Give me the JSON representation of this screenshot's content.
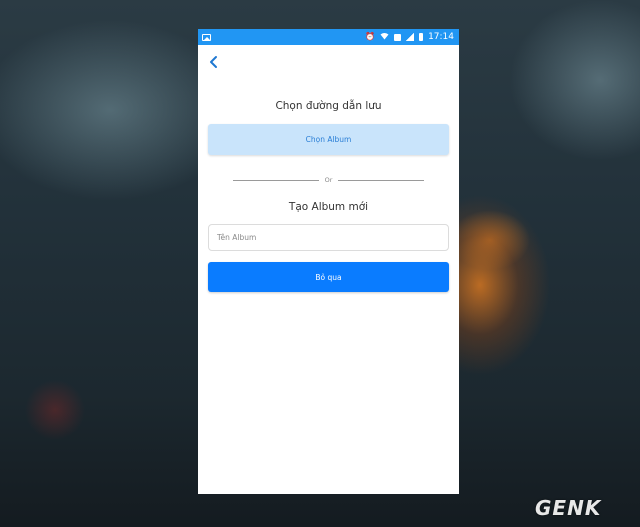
{
  "status_bar": {
    "time": "17:14",
    "icons": [
      "image-icon",
      "alarm-icon",
      "wifi-icon",
      "sim-icon",
      "signal-icon",
      "battery-icon"
    ],
    "color": "#2196f3"
  },
  "header": {
    "back_icon": "chevron-left-icon"
  },
  "main": {
    "choose_path_title": "Chọn đường dẫn lưu",
    "choose_album_label": "Chọn Album",
    "or_label": "Or",
    "create_album_title": "Tạo Album mới",
    "album_name_placeholder": "Tên Album",
    "album_name_value": "",
    "skip_label": "Bỏ qua"
  },
  "colors": {
    "accent": "#0a7cff",
    "choose_album_bg": "#c9e4fb",
    "choose_album_text": "#2b7fd6"
  },
  "watermark": {
    "text": "GENK"
  }
}
